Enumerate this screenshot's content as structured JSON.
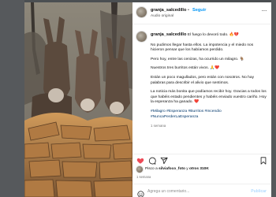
{
  "post": {
    "username": "granja_salcedillo",
    "separator": "•",
    "follow_label": "Seguir",
    "audio_label": "Audio original",
    "more_label": "···"
  },
  "caption": {
    "username": "granja_salcedillo",
    "first_line": "El fuego lo devoró todo. 🔥💔",
    "paragraphs": [
      "No pudimos llegar hasta ellos. La impotencia y el miedo nos hicieron pensar que los habíamos perdido.",
      "Pero hoy, entre las cenizas, ha ocurrido un milagro. 🐐",
      "Nuestros tres burritos están vivos. 🙏❤️",
      "Están un poco magullados, pero están con nosotros. No hay palabras para describir el alivio que sentimos.",
      "La noticia más bonita que podíamos recibir hoy. Gracias a todos los que habéis estado pendientes y habéis enviado vuestro cariño. Hoy la esperanza ha ganado. ❤️"
    ],
    "hashtags": "#Milagro #Esperanza #Burritos #Incendio #NuncaPerderLaEsperanza",
    "time_ago": "1 semana"
  },
  "actions": {
    "like_icon": "heart-icon",
    "comment_icon": "comment-icon",
    "share_icon": "share-icon",
    "save_icon": "bookmark-icon",
    "like_color": "#ed4956"
  },
  "likes": {
    "prefix": "Pisco a ",
    "name": "silviafoco_foto",
    "middle": " y ",
    "count_text": "otros 310K"
  },
  "date_label": "1 semana",
  "comment_box": {
    "placeholder": "Agrega un comentario...",
    "publish_label": "Publicar"
  }
}
